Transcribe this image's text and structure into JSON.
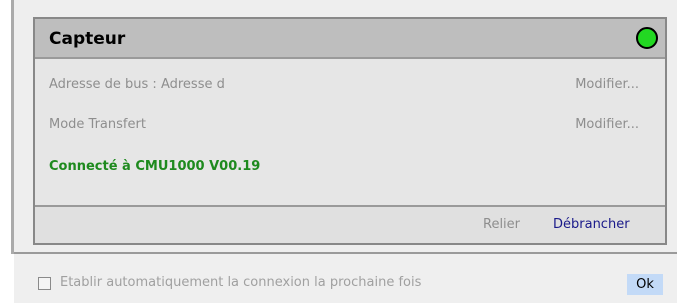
{
  "panel": {
    "title": "Capteur",
    "status_color": "#22d822",
    "rows": [
      {
        "label": "Adresse de bus : Adresse d",
        "action": "Modifier..."
      },
      {
        "label": "Mode Transfert",
        "action": "Modifier..."
      }
    ],
    "connection_status": "Connecté à  CMU1000 V00.19",
    "connection_color": "#1e8a1e"
  },
  "footer": {
    "relier_label": "Relier",
    "relier_color": "#8e8e8e",
    "debrancher_label": "Débrancher",
    "debrancher_color": "#1a1a8a"
  },
  "bottom_bar": {
    "auto_connect_checked": false,
    "auto_connect_label": "Etablir automatiquement la connexion la prochaine fois",
    "ok_label": "Ok"
  },
  "icons": {
    "status": "status-led-icon",
    "checkbox": "checkbox-icon"
  }
}
